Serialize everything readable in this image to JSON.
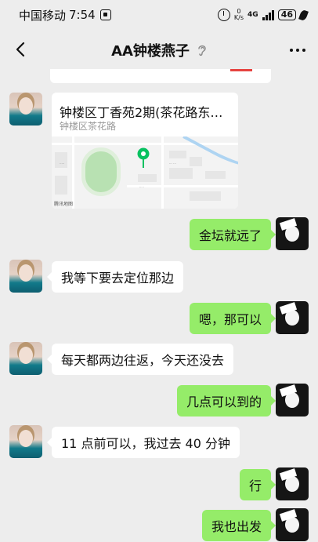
{
  "status_bar": {
    "carrier": "中国移动",
    "time": "7:54",
    "speed_value": "0",
    "speed_unit": "K/s",
    "network": "4G",
    "battery": "46"
  },
  "header": {
    "title": "AA钟楼燕子"
  },
  "location_card": {
    "title": "钟楼区丁香苑2期(茶花路东…",
    "address": "钟楼区茶花路",
    "map_logo": "腾讯地图"
  },
  "messages": [
    {
      "side": "right",
      "text": "金坛就远了"
    },
    {
      "side": "left",
      "text": "我等下要去定位那边"
    },
    {
      "side": "right",
      "text": "嗯，那可以"
    },
    {
      "side": "left",
      "text": "每天都两边往返，今天还没去"
    },
    {
      "side": "right",
      "text": "几点可以到的"
    },
    {
      "side": "left",
      "text": "11 点前可以，我过去 40 分钟"
    },
    {
      "side": "right",
      "text": "行"
    },
    {
      "side": "right",
      "text": "我也出发"
    }
  ],
  "colors": {
    "background": "#ededed",
    "outgoing_bubble": "#95ec69",
    "incoming_bubble": "#ffffff",
    "map_pin": "#07c160"
  },
  "icons": [
    "notification-icon",
    "alarm-icon",
    "signal-icon",
    "battery-icon",
    "back-icon",
    "ear-icon",
    "more-icon",
    "map-pin-icon"
  ]
}
